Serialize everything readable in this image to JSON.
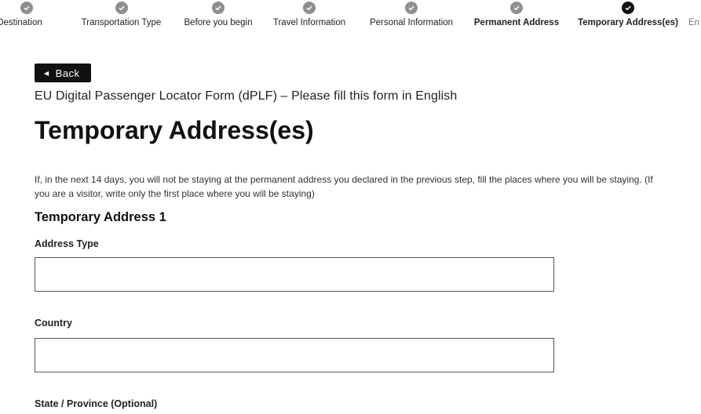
{
  "stepper": {
    "steps": [
      {
        "label": "Destination",
        "status": "completed"
      },
      {
        "label": "Transportation Type",
        "status": "completed"
      },
      {
        "label": "Before you begin",
        "status": "completed"
      },
      {
        "label": "Travel Information",
        "status": "completed"
      },
      {
        "label": "Personal Information",
        "status": "completed"
      },
      {
        "label": "Permanent Address",
        "status": "completed"
      },
      {
        "label": "Temporary Address(es)",
        "status": "current"
      },
      {
        "label": "En",
        "status": "upcoming"
      }
    ]
  },
  "back_button": {
    "label": "Back"
  },
  "form_subtitle": "EU Digital Passenger Locator Form (dPLF) – Please fill this form in English",
  "page_title": "Temporary Address(es)",
  "intro_text": "If, in the next 14 days, you will not be staying at the permanent address you declared in the previous step, fill the places where you will be staying. (If you are a visitor, write only the first place where you will be staying)",
  "section": {
    "title": "Temporary Address 1",
    "fields": [
      {
        "label": "Address Type",
        "value": ""
      },
      {
        "label": "Country",
        "value": ""
      },
      {
        "label": "State / Province (Optional)",
        "value": ""
      }
    ]
  },
  "colors": {
    "completed_step": "#8f8f8f",
    "current_step": "#111111",
    "button_bg": "#111111"
  }
}
